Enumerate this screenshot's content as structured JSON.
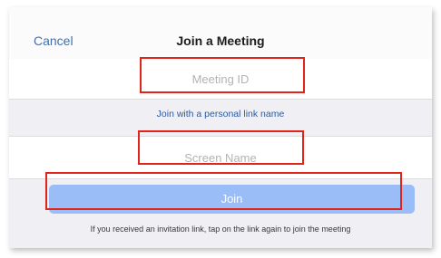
{
  "header": {
    "cancel_label": "Cancel",
    "title": "Join a Meeting"
  },
  "meeting_id": {
    "value": "",
    "placeholder": "Meeting ID"
  },
  "personal_link_label": "Join with a personal link name",
  "screen_name": {
    "value": "",
    "placeholder": "Screen Name"
  },
  "join_button_label": "Join",
  "hint_text": "If you received an invitation link, tap on the link again to join the meeting",
  "colors": {
    "link_blue": "#3d6fb6",
    "join_button_bg": "#9bbdf7",
    "highlight_red": "#e2231a",
    "background": "#efeff4"
  }
}
